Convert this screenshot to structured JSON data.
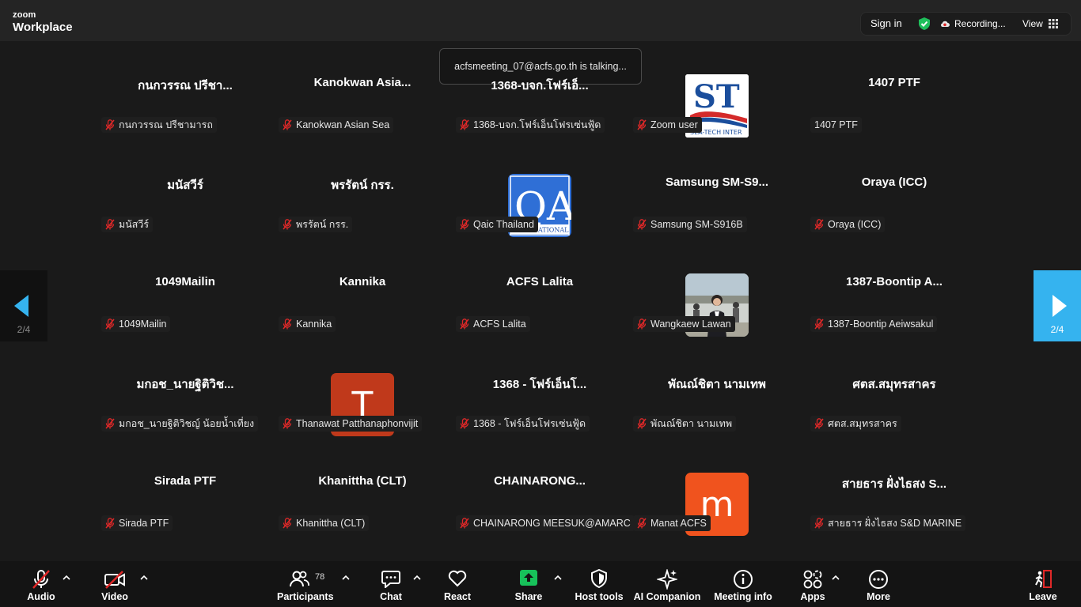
{
  "app": {
    "brand_small": "zoom",
    "brand_large": "Workplace"
  },
  "topbar": {
    "sign_in": "Sign in",
    "recording": "Recording...",
    "view": "View"
  },
  "toast": "acfsmeeting_07@acfs.go.th is talking...",
  "nav": {
    "left_page": "2/4",
    "right_page": "2/4"
  },
  "tiles": [
    {
      "big": "กนกวรรณ  ปรีชา...",
      "name": "กนกวรรณ  ปรีชามารถ",
      "muted": true
    },
    {
      "big": "Kanokwan  Asia...",
      "name": "Kanokwan Asian Sea",
      "muted": true
    },
    {
      "big": "1368-บจก.โฟร์เอ็...",
      "name": "1368-บจก.โฟร์เอ็นโฟรเซ่นฟู้ด",
      "muted": true
    },
    {
      "avatar": "logo-st",
      "logo_text": "SEA-TECH INTER",
      "name": "Zoom user",
      "muted": true
    },
    {
      "big": "1407 PTF",
      "name": "1407 PTF",
      "muted": false
    },
    {
      "big": "มนัสวีร์",
      "name": "มนัสวีร์",
      "muted": true
    },
    {
      "big": "พรรัตน์ กรร.",
      "name": "พรรัตน์ กรร.",
      "muted": true
    },
    {
      "avatar": "logo-qa",
      "logo_text": "INTERNATIONAL",
      "name": "Qaic Thailand",
      "muted": true
    },
    {
      "big": "Samsung  SM-S9...",
      "name": "Samsung SM-S916B",
      "muted": true
    },
    {
      "big": "Oraya (ICC)",
      "name": "Oraya (ICC)",
      "muted": true
    },
    {
      "big": "1049Mailin",
      "name": "1049Mailin",
      "muted": true
    },
    {
      "big": "Kannika",
      "name": "Kannika",
      "muted": true
    },
    {
      "big": "ACFS Lalita",
      "name": "ACFS Lalita",
      "muted": true
    },
    {
      "avatar": "photo",
      "name": "Wangkaew Lawan",
      "muted": true
    },
    {
      "big": "1387-Boontip  A...",
      "name": "1387-Boontip Aeiwsakul",
      "muted": true
    },
    {
      "big": "มกอช_นายฐิติวิช...",
      "name": "มกอช_นายฐิติวิชญ์ น้อยน้ำเที่ยง",
      "muted": true
    },
    {
      "avatar": "letter",
      "letter": "T",
      "color": "#c0391b",
      "name": "Thanawat Patthanaphonvijit",
      "muted": true
    },
    {
      "big": "1368 - โฟร์เอ็นโ...",
      "name": "1368 - โฟร์เอ็นโฟรเซ่นฟู้ด",
      "muted": true
    },
    {
      "big": "พัณณ์ชิตา นามเทพ",
      "name": "พัณณ์ชิตา นามเทพ",
      "muted": true
    },
    {
      "big": "ศตส.สมุทรสาคร",
      "name": "ศตส.สมุทรสาคร",
      "muted": true
    },
    {
      "big": "Sirada PTF",
      "name": "Sirada PTF",
      "muted": true
    },
    {
      "big": "Khanittha (CLT)",
      "name": "Khanittha (CLT)",
      "muted": true
    },
    {
      "big": "CHAINARONG...",
      "name": "CHAINARONG MEESUK@AMARC",
      "muted": true
    },
    {
      "avatar": "letter",
      "letter": "m",
      "color": "#f0531e",
      "name": "Manat ACFS",
      "muted": true
    },
    {
      "big": "สายธาร ฝั่งไธสง S...",
      "name": "สายธาร ฝั่งไธสง S&D MARINE",
      "muted": true
    }
  ],
  "toolbar": {
    "audio": "Audio",
    "video": "Video",
    "participants": "Participants",
    "participants_count": "78",
    "chat": "Chat",
    "react": "React",
    "share": "Share",
    "host_tools": "Host tools",
    "ai_companion": "AI Companion",
    "meeting_info": "Meeting info",
    "apps": "Apps",
    "more": "More",
    "leave": "Leave"
  },
  "colors": {
    "share": "#17c25a",
    "accent": "#35b3ef",
    "leave": "#e02828",
    "shield": "#1fbf5b"
  }
}
